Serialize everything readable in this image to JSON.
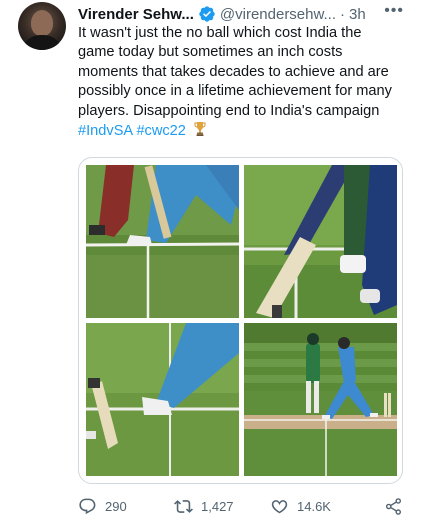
{
  "tweet": {
    "author_name": "Virender Sehw...",
    "author_handle": "@virendersehw...",
    "separator": "·",
    "time": "3h",
    "more_label": "•••",
    "text_lines": [
      "It wasn't just the no ball which cost India the",
      "game today but sometimes an inch costs",
      "moments that takes decades to achieve and are",
      "possibly once in a lifetime achievement for many",
      "players. Disappointing end to India's campaign"
    ],
    "hashtags": [
      "#IndvSA",
      "#cwc22"
    ],
    "emoji": "trophy-icon",
    "media": [
      {
        "name": "no-ball-closeup-feet"
      },
      {
        "name": "bat-at-crease-closeup"
      },
      {
        "name": "foot-over-crease-closeup"
      },
      {
        "name": "wide-shot-runout"
      }
    ],
    "actions": {
      "reply_count": "290",
      "retweet_count": "1,427",
      "like_count": "14.6K"
    }
  },
  "colors": {
    "text": "#0f1419",
    "secondary": "#536471",
    "link": "#1d9bf0",
    "verified": "#1d9bf0",
    "border": "#cfd9de"
  }
}
